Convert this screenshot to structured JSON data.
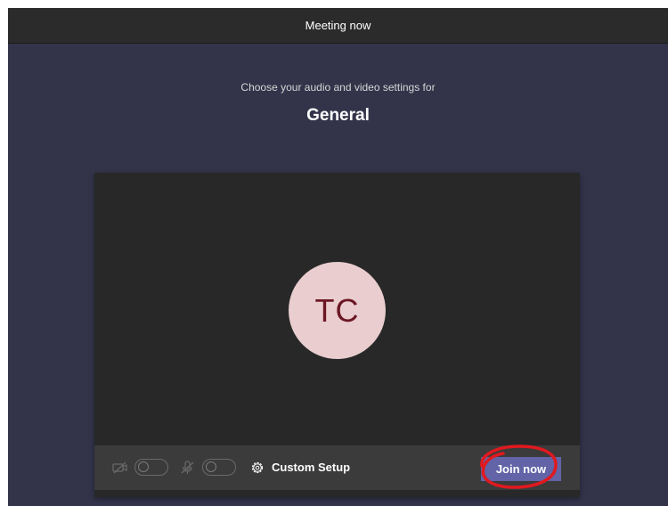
{
  "titlebar": {
    "title": "Meeting now"
  },
  "prejoin": {
    "subtitle": "Choose your audio and video settings for",
    "channel": "General",
    "avatar_initials": "TC"
  },
  "controls": {
    "video_toggle": "off",
    "audio_toggle": "off",
    "custom_setup_label": "Custom Setup",
    "join_label": "Join now"
  },
  "colors": {
    "background": "#33344a",
    "titlebar": "#2b2b2b",
    "join_button": "#6264a7",
    "avatar_bg": "#e9cdcf",
    "avatar_text": "#6b1624",
    "annotation": "#e0191f"
  },
  "icons": [
    "camera-off-icon",
    "mic-off-icon",
    "gear-icon"
  ]
}
